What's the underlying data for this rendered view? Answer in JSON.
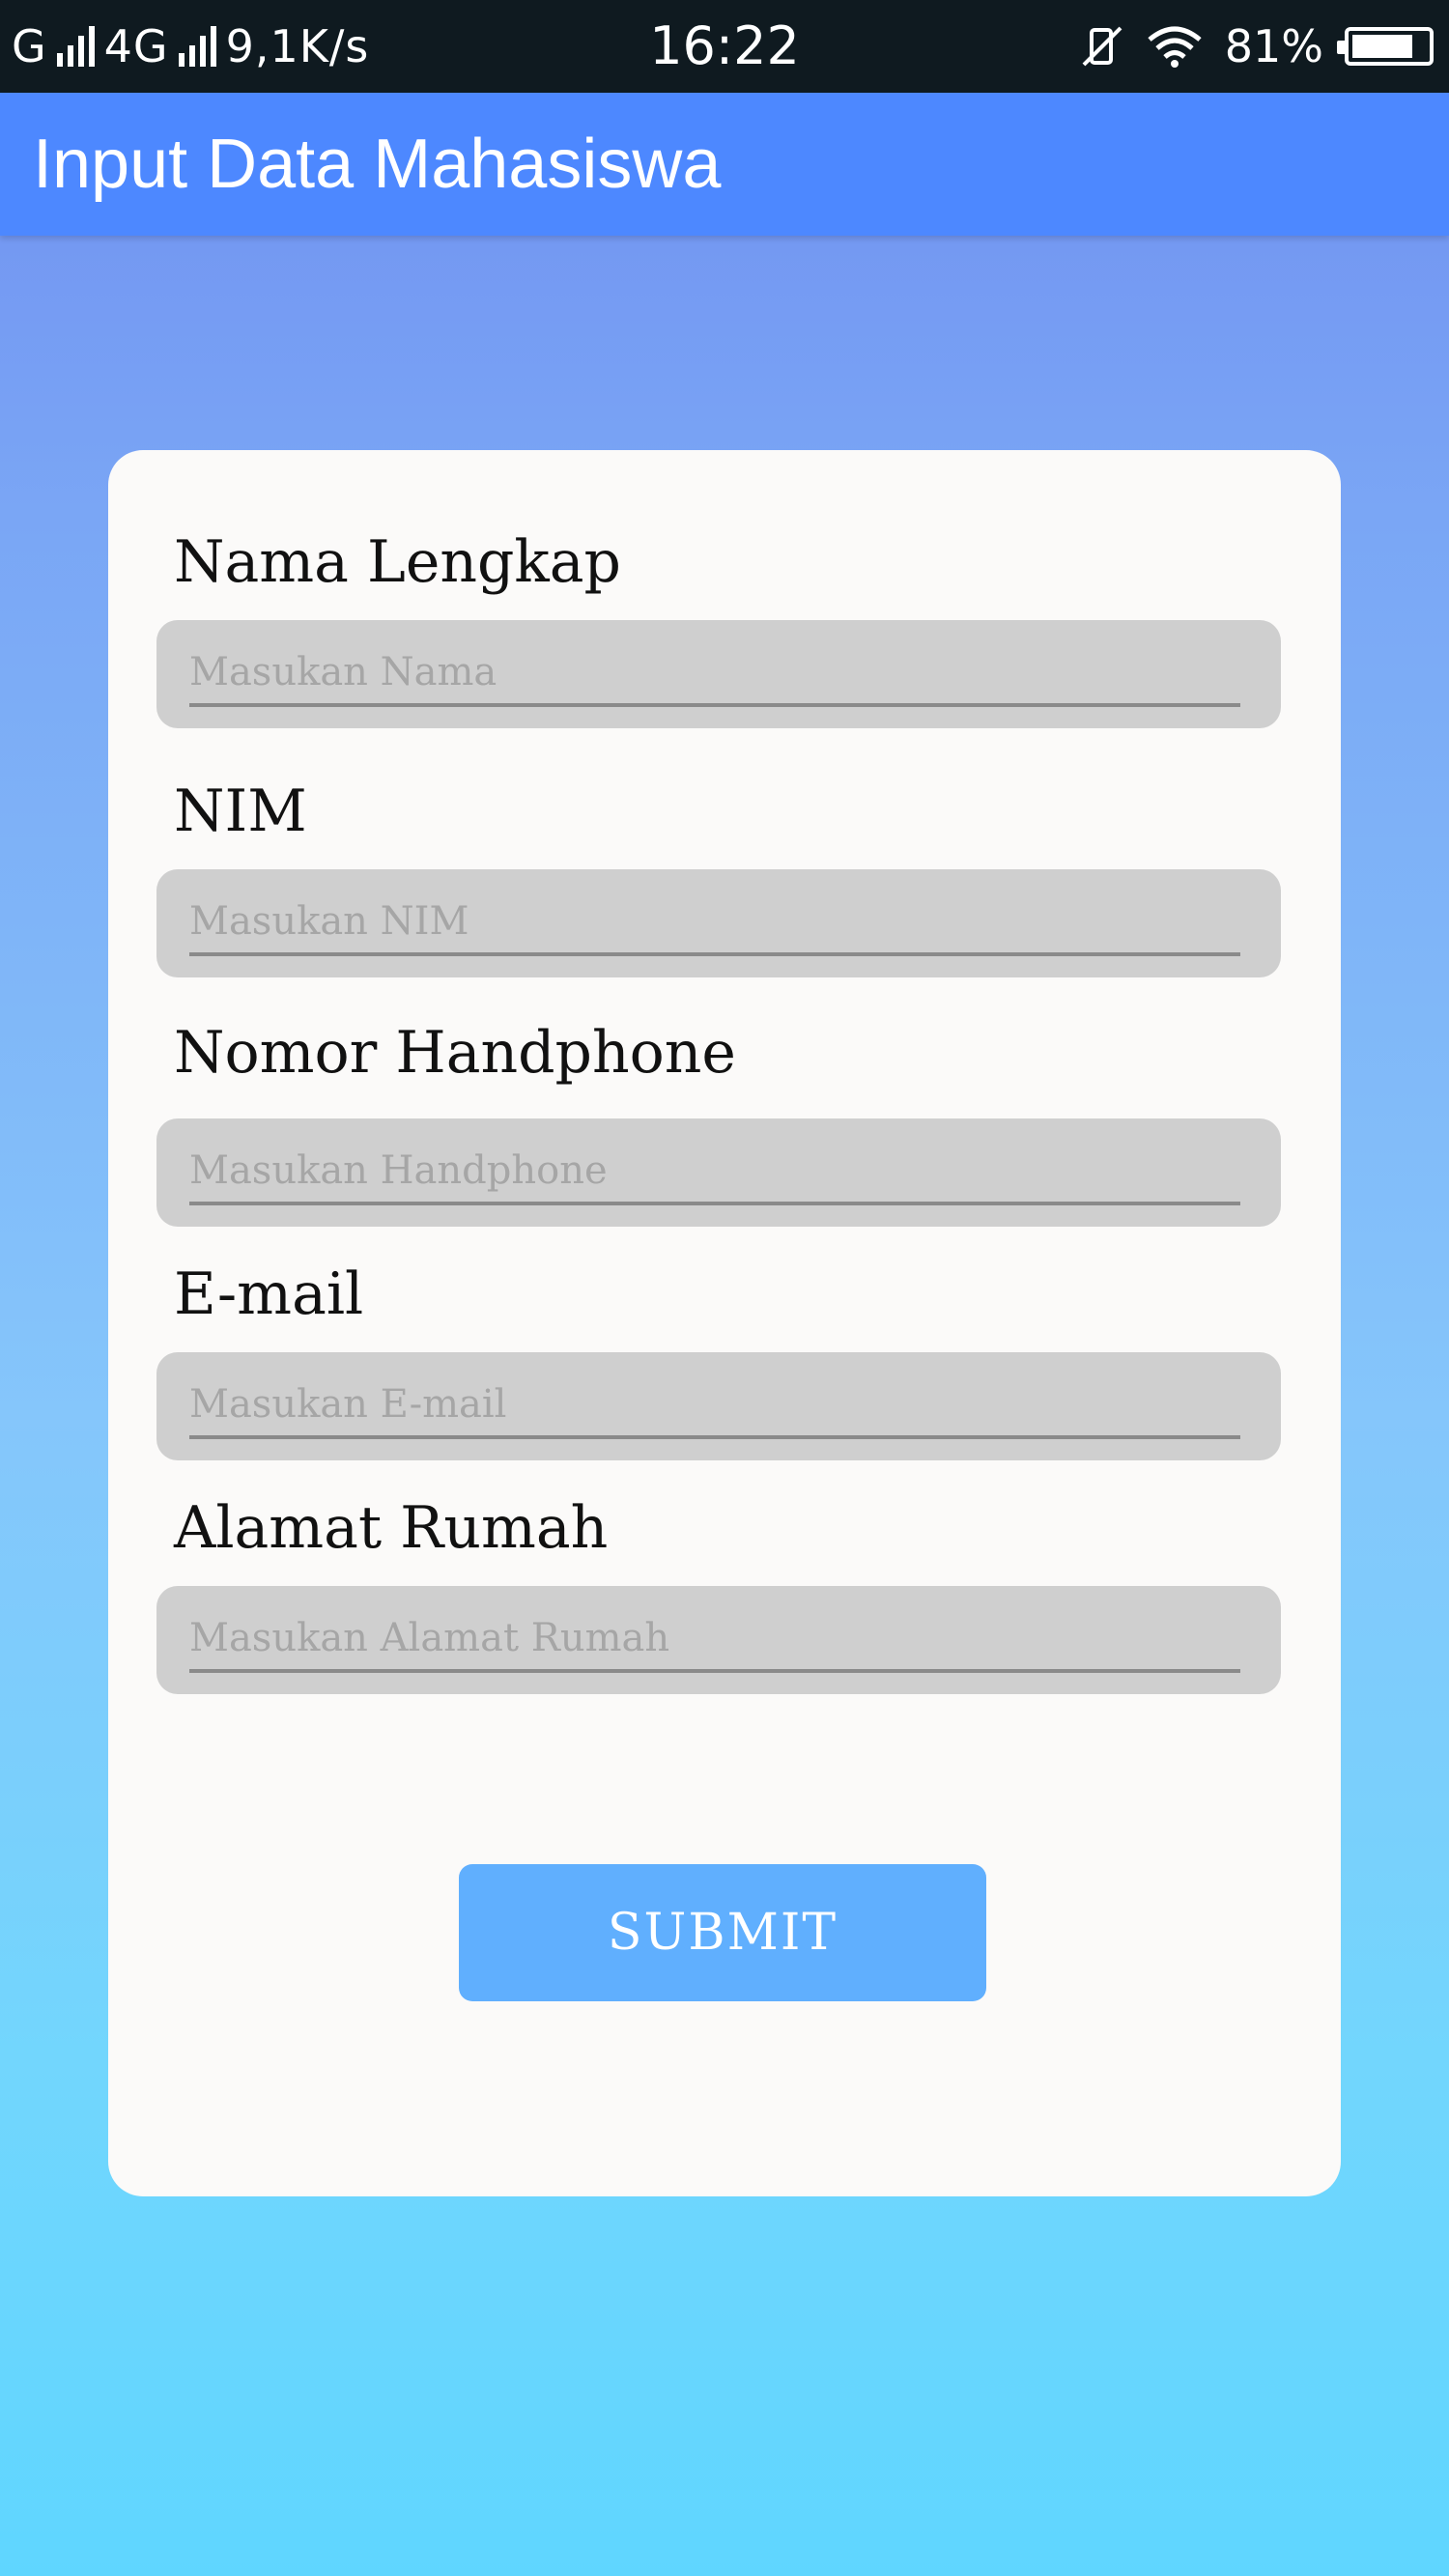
{
  "status_bar": {
    "carrier_1": "G",
    "carrier_2": "4G",
    "speed": "9,1K/s",
    "time": "16:22",
    "battery_percent": "81%",
    "battery_level": 0.81,
    "icons": [
      "signal-icon",
      "signal-icon",
      "vibrate-off-icon",
      "wifi-icon",
      "battery-icon"
    ]
  },
  "app_bar": {
    "title": "Input Data Mahasiswa",
    "color": "#4d88ff"
  },
  "form": {
    "fields": [
      {
        "label": "Nama Lengkap",
        "placeholder": "Masukan Nama",
        "value": ""
      },
      {
        "label": "NIM",
        "placeholder": "Masukan NIM",
        "value": ""
      },
      {
        "label": "Nomor Handphone",
        "placeholder": "Masukan Handphone",
        "value": ""
      },
      {
        "label": "E-mail",
        "placeholder": "Masukan E-mail",
        "value": ""
      },
      {
        "label": "Alamat Rumah",
        "placeholder": "Masukan Alamat Rumah",
        "value": ""
      }
    ],
    "submit_label": "SUBMIT",
    "submit_color": "#60affe"
  }
}
